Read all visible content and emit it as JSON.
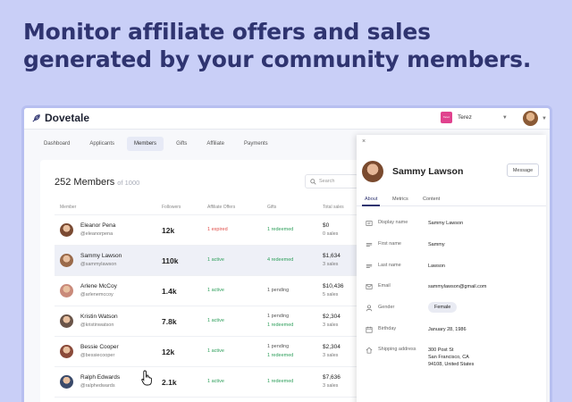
{
  "headline": "Monitor affiliate offers and sales generated by your community members.",
  "app": {
    "logo": "Dovetale",
    "store": {
      "thumb_text": "Tarez",
      "name": "Terez"
    }
  },
  "nav": [
    "Dashboard",
    "Applicants",
    "Members",
    "Gifts",
    "Affiliate",
    "Payments"
  ],
  "members": {
    "title": "252 Members",
    "subtitle": "of 1000",
    "search_placeholder": "Search",
    "columns": [
      "Member",
      "Followers",
      "Affiliate Offers",
      "Gifts",
      "Total sales"
    ],
    "rows": [
      {
        "name": "Eleanor Pena",
        "handle": "@eleanorpena",
        "followers": "12k",
        "offers": "1 expired",
        "gifts": [
          "1 redeemed"
        ],
        "sales": "$0",
        "sales_count": "0 sales",
        "color": "#7a4a32"
      },
      {
        "name": "Sammy Lawson",
        "handle": "@sammylawson",
        "followers": "110k",
        "offers": "1 active",
        "gifts": [
          "4 redeemed"
        ],
        "sales": "$1,634",
        "sales_count": "3 sales",
        "color": "#9a6a4a"
      },
      {
        "name": "Arlene McCoy",
        "handle": "@arlenemccoy",
        "followers": "1.4k",
        "offers": "1 active",
        "gifts": [
          "1 pending"
        ],
        "sales": "$10,436",
        "sales_count": "5 sales",
        "color": "#c98a7a"
      },
      {
        "name": "Kristin Watson",
        "handle": "@kristinwatson",
        "followers": "7.8k",
        "offers": "1 active",
        "gifts": [
          "1 pending",
          "1 redeemed"
        ],
        "sales": "$2,304",
        "sales_count": "3 sales",
        "color": "#6a5448"
      },
      {
        "name": "Bessie Cooper",
        "handle": "@bessiecooper",
        "followers": "12k",
        "offers": "1 active",
        "gifts": [
          "1 pending",
          "1 redeemed"
        ],
        "sales": "$2,304",
        "sales_count": "3 sales",
        "color": "#8a4a3a"
      },
      {
        "name": "Ralph Edwards",
        "handle": "@ralphedwards",
        "followers": "2.1k",
        "offers": "1 active",
        "gifts": [
          "1 redeemed"
        ],
        "sales": "$7,636",
        "sales_count": "3 sales",
        "color": "#3a4a6a"
      }
    ]
  },
  "panel": {
    "close": "×",
    "name": "Sammy Lawson",
    "message_button": "Message",
    "tabs": [
      "About",
      "Metrics",
      "Content"
    ],
    "fields": [
      {
        "label": "Display name",
        "value": "Sammy Lawson",
        "icon": "id-card-icon"
      },
      {
        "label": "First name",
        "value": "Sammy",
        "icon": "text-lines-icon"
      },
      {
        "label": "Last name",
        "value": "Lawson",
        "icon": "text-lines-icon"
      },
      {
        "label": "Email",
        "value": "sammylawson@gmail.com",
        "icon": "envelope-icon"
      },
      {
        "label": "Gender",
        "value": "Female",
        "icon": "person-icon"
      },
      {
        "label": "Birthday",
        "value": "January 28, 1986",
        "icon": "calendar-icon"
      },
      {
        "label": "Shipping address",
        "value": "300 Post St\nSan Francisco, CA\n94108, United States",
        "icon": "home-icon"
      }
    ]
  },
  "colors": {
    "headline": "#2f3470",
    "background": "#c9cff7",
    "active": "#2e9f5b",
    "expired": "#e0504c"
  }
}
